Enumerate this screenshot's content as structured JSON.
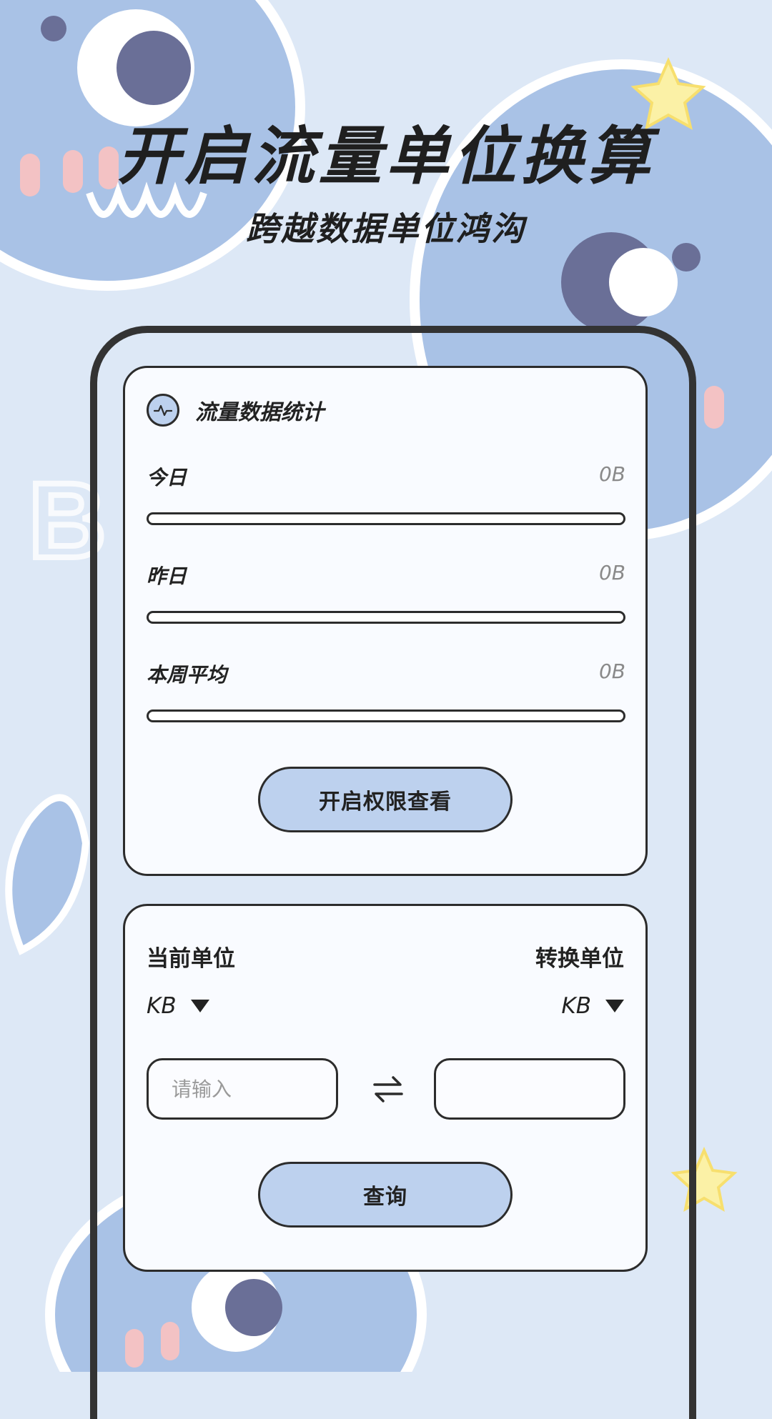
{
  "headline": "开启流量单位换算",
  "subheadline": "跨越数据单位鸿沟",
  "stats_card": {
    "title": "流量数据统计",
    "icon": "pulse-icon",
    "rows": [
      {
        "label": "今日",
        "value": "0B",
        "progress": 0
      },
      {
        "label": "昨日",
        "value": "0B",
        "progress": 0
      },
      {
        "label": "本周平均",
        "value": "0B",
        "progress": 0
      }
    ],
    "button_label": "开启权限查看"
  },
  "converter_card": {
    "from_label": "当前单位",
    "to_label": "转换单位",
    "from_unit": "KB",
    "to_unit": "KB",
    "input_placeholder": "请输入",
    "input_value": "",
    "output_value": "",
    "swap_icon": "swap-arrows-icon",
    "query_label": "查询"
  },
  "colors": {
    "accent": "#bdd1ee",
    "background": "#dde8f6",
    "outline": "#2c2c2c"
  }
}
